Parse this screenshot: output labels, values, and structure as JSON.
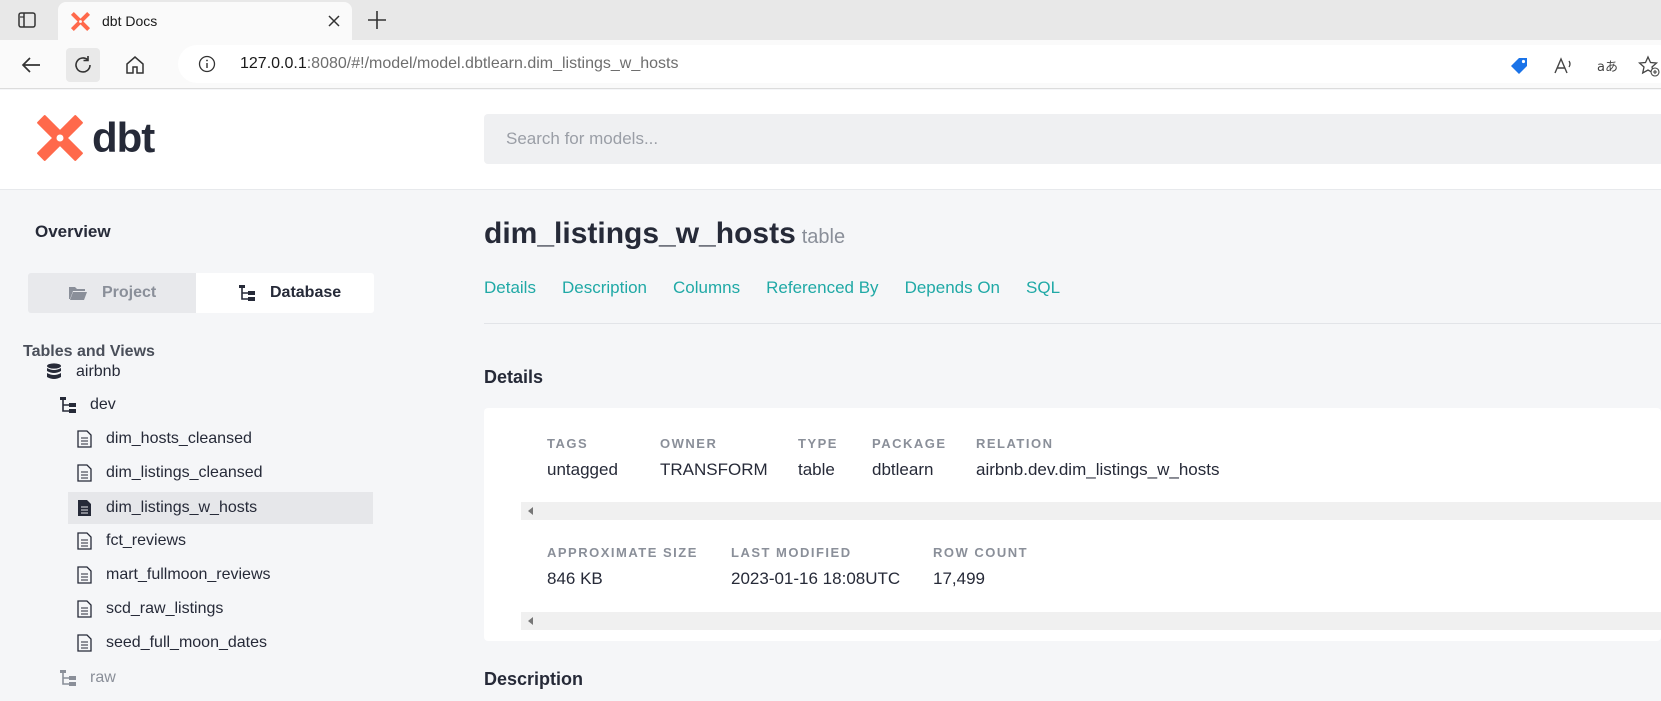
{
  "browser": {
    "tab_title": "dbt Docs",
    "url_host": "127.0.0.1",
    "url_rest": ":8080/#!/model/model.dbtlearn.dim_listings_w_hosts"
  },
  "header": {
    "logo_text": "dbt",
    "search_placeholder": "Search for models..."
  },
  "sidebar": {
    "overview": "Overview",
    "switch": {
      "project": "Project",
      "database": "Database",
      "selected": "Database"
    },
    "tables_heading": "Tables and Views",
    "database": "airbnb",
    "schema": "dev",
    "models": [
      "dim_hosts_cleansed",
      "dim_listings_cleansed",
      "dim_listings_w_hosts",
      "fct_reviews",
      "mart_fullmoon_reviews",
      "scd_raw_listings",
      "seed_full_moon_dates"
    ],
    "active_model": "dim_listings_w_hosts",
    "schema2": "raw"
  },
  "main": {
    "model_name": "dim_listings_w_hosts",
    "materialization": "table",
    "nav": [
      "Details",
      "Description",
      "Columns",
      "Referenced By",
      "Depends On",
      "SQL"
    ],
    "details_heading": "Details",
    "row1": [
      {
        "label": "TAGS",
        "value": "untagged"
      },
      {
        "label": "OWNER",
        "value": "TRANSFORM"
      },
      {
        "label": "TYPE",
        "value": "table"
      },
      {
        "label": "PACKAGE",
        "value": "dbtlearn"
      },
      {
        "label": "RELATION",
        "value": "airbnb.dev.dim_listings_w_hosts"
      }
    ],
    "row2": [
      {
        "label": "APPROXIMATE SIZE",
        "value": "846 KB"
      },
      {
        "label": "LAST MODIFIED",
        "value": "2023-01-16 18:08UTC"
      },
      {
        "label": "ROW COUNT",
        "value": "17,499"
      }
    ],
    "description_heading": "Description"
  },
  "colors": {
    "accent": "#20a9a6",
    "brand": "#ff694b",
    "text": "#262a38"
  }
}
